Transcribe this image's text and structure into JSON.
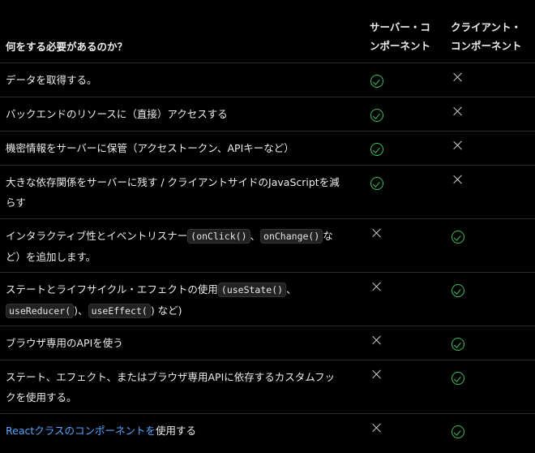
{
  "header": {
    "question": "何をする必要があるのか？",
    "server_line1": "サーバー・コ",
    "server_line2": "ンポーネント",
    "client_line1": "クライアント・",
    "client_line2": "コンポーネント"
  },
  "rows": [
    {
      "text": "データを取得する。",
      "server": "check-icon",
      "client": "x-icon"
    },
    {
      "text": "バックエンドのリソースに（直接）アクセスする",
      "server": "check-icon",
      "client": "x-icon"
    },
    {
      "text": "機密情報をサーバーに保管（アクセストークン、APIキーなど）",
      "server": "check-icon",
      "client": "x-icon"
    },
    {
      "text_line1": "大きな依存関係をサーバーに残す / クライアントサイドのJavaScriptを減",
      "text_line2": "らす",
      "server": "check-icon",
      "client": "x-icon"
    },
    {
      "text_a": "インタラクティブ性とイベントリスナー",
      "code1": "(onClick()",
      "sep": "、",
      "code2": "onChange()",
      "text_b": "な",
      "text_c": "ど）を追加します。",
      "server": "x-icon",
      "client": "check-icon"
    },
    {
      "text_a": "ステートとライフサイクル・エフェクトの使用",
      "code1": "(useState()",
      "sep1": "、",
      "code2": "useReducer(",
      "sep2": ")、",
      "code3": "useEffect(",
      "text_b": ") など)",
      "server": "x-icon",
      "client": "check-icon"
    },
    {
      "text": "ブラウザ専用のAPIを使う",
      "server": "x-icon",
      "client": "check-icon"
    },
    {
      "text_line1": "ステート、エフェクト、またはブラウザ専用APIに依存するカスタムフッ",
      "text_line2": "クを使用する。",
      "server": "x-icon",
      "client": "check-icon"
    },
    {
      "link": "Reactクラスのコンポーネントを",
      "text": "使用する",
      "server": "x-icon",
      "client": "check-icon"
    }
  ],
  "colors": {
    "check": "#3fbf5f",
    "link": "#58a6ff",
    "background": "#000000"
  }
}
